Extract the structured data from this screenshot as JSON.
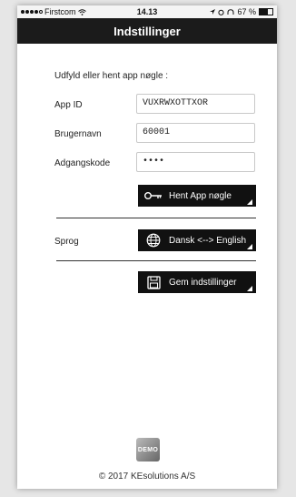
{
  "statusbar": {
    "carrier": "Firstcom",
    "time": "14.13",
    "battery_text": "67 %",
    "battery_level": 0.67
  },
  "header": {
    "title": "Indstillinger"
  },
  "form": {
    "intro": "Udfyld eller hent app nøgle :",
    "app_id_label": "App ID",
    "app_id_value": "VUXRWXOTTXOR",
    "username_label": "Brugernavn",
    "username_value": "60001",
    "password_label": "Adgangskode",
    "password_value": "••••"
  },
  "buttons": {
    "fetch_key": "Hent App nøgle",
    "language": "Dansk <--> English",
    "save": "Gem indstillinger"
  },
  "language": {
    "label": "Sprog"
  },
  "demo_badge": "DEMO",
  "footer": {
    "copyright": "© 2017 KEsolutions A/S"
  },
  "icons": {
    "fetch_key": "key-icon",
    "language": "globe-icon",
    "save": "floppy-icon"
  }
}
